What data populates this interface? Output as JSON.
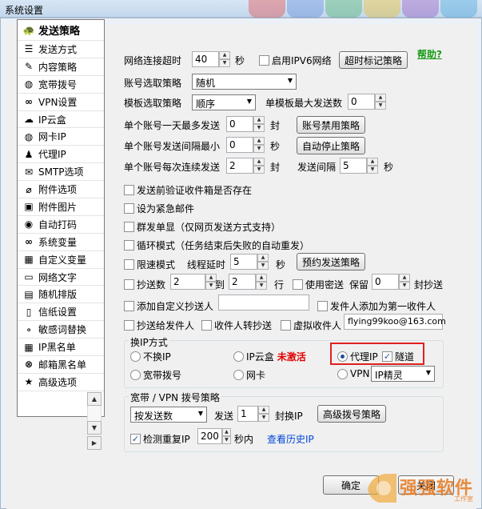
{
  "window": {
    "title": "系统设置"
  },
  "sidebar": {
    "items": [
      {
        "label": "发送策略",
        "icon": "tortoise-icon",
        "glyph": "🐢"
      },
      {
        "label": "发送方式",
        "icon": "list-icon",
        "glyph": "☰"
      },
      {
        "label": "内容策略",
        "icon": "pencil-icon",
        "glyph": "✎"
      },
      {
        "label": "宽带拨号",
        "icon": "globe-icon",
        "glyph": "◍"
      },
      {
        "label": "VPN设置",
        "icon": "link-icon",
        "glyph": "∞"
      },
      {
        "label": "IP云盒",
        "icon": "cloud-icon",
        "glyph": "☁"
      },
      {
        "label": "网卡IP",
        "icon": "globe-icon",
        "glyph": "◍"
      },
      {
        "label": "代理IP",
        "icon": "user-icon",
        "glyph": "♟"
      },
      {
        "label": "SMTP选项",
        "icon": "envelope-icon",
        "glyph": "✉"
      },
      {
        "label": "附件选项",
        "icon": "paperclip-icon",
        "glyph": "⌀"
      },
      {
        "label": "附件图片",
        "icon": "image-icon",
        "glyph": "▣"
      },
      {
        "label": "自动打码",
        "icon": "eye-icon",
        "glyph": "◉"
      },
      {
        "label": "系统变量",
        "icon": "infinity-icon",
        "glyph": "∞"
      },
      {
        "label": "自定义变量",
        "icon": "grid-icon",
        "glyph": "▦"
      },
      {
        "label": "网络文字",
        "icon": "map-icon",
        "glyph": "▭"
      },
      {
        "label": "随机排版",
        "icon": "shuffle-icon",
        "glyph": "▤"
      },
      {
        "label": "信纸设置",
        "icon": "document-icon",
        "glyph": "▯"
      },
      {
        "label": "敏感词替换",
        "icon": "dots-icon",
        "glyph": "∘"
      },
      {
        "label": "IP黑名单",
        "icon": "grid-icon",
        "glyph": "▦"
      },
      {
        "label": "邮箱黑名单",
        "icon": "close-circle-icon",
        "glyph": "⊗"
      },
      {
        "label": "高级选项",
        "icon": "star-icon",
        "glyph": "★"
      }
    ]
  },
  "main": {
    "help": "帮助?",
    "timeout_label": "网络连接超时",
    "timeout_value": "40",
    "sec": "秒",
    "ipv6_label": "启用IPV6网络",
    "timeout_mark_btn": "超时标记策略",
    "account_strategy_label": "账号选取策略",
    "account_strategy_value": "随机",
    "template_strategy_label": "模板选取策略",
    "template_strategy_value": "顺序",
    "template_max_label": "单模板最大发送数",
    "template_max_value": "0",
    "daily_max_label": "单个账号一天最多发送",
    "daily_max_value": "0",
    "feng": "封",
    "account_ban_btn": "账号禁用策略",
    "interval_min_label": "单个账号发送间隔最小",
    "interval_min_value": "0",
    "auto_stop_btn": "自动停止策略",
    "consecutive_label": "单个账号每次连续发送",
    "consecutive_value": "2",
    "send_interval_label": "发送间隔",
    "send_interval_value": "5",
    "verify_inbox": "发送前验证收件箱是否存在",
    "urgent": "设为紧急邮件",
    "group_single": "群发单显（仅网页发送方式支持）",
    "loop_mode": "循环模式（任务结束后失败的自动重发）",
    "speed_limit": "限速模式",
    "thread_delay_label": "线程延时",
    "thread_delay_value": "5",
    "appoint_btn": "预约发送策略",
    "cc_count_label": "抄送数",
    "cc_from": "2",
    "dao": "到",
    "cc_to": "2",
    "hang": "行",
    "use_bcc": "使用密送",
    "keep": "保留",
    "keep_value": "0",
    "feng_cc": "封抄送",
    "add_custom_cc": "添加自定义抄送人",
    "sender_first": "发件人添加为第一收件人",
    "cc_to_sender": "抄送给发件人",
    "recipient_forward": "收件人转抄送",
    "virtual_recipient": "虚拟收件人",
    "virtual_email": "flying99koo@163.com"
  },
  "ip_group": {
    "title": "换IP方式",
    "no_ip": "不换IP",
    "ip_cloud": "IP云盒",
    "not_activated": "未激活",
    "proxy_ip": "代理IP",
    "tunnel": "隧道",
    "broadband": "宽带拨号",
    "nic": "网卡",
    "vpn": "VPN",
    "vpn_select": "IP精灵"
  },
  "dial_group": {
    "title": "宽带 / VPN 拨号策略",
    "mode": "按发送数",
    "send": "发送",
    "send_value": "1",
    "feng_ip": "封换IP",
    "adv_btn": "高级拨号策略",
    "check_dup": "检测重复IP",
    "check_value": "200",
    "within_sec": "秒内",
    "history": "查看历史IP"
  },
  "footer": {
    "ok": "确定",
    "close": "关闭"
  },
  "watermark": {
    "brand": "强强软件",
    "sub": "工作室"
  }
}
